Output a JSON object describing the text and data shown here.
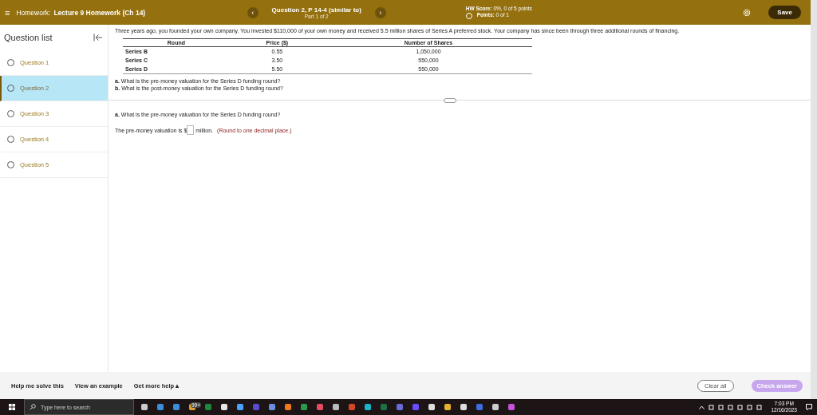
{
  "header": {
    "menu_icon": "≡",
    "prefix": "Homework:",
    "title": "Lecture 9 Homework (Ch 14)",
    "question": "Question 2, P 14-4 (similar to)",
    "part": "Part 1 of 2",
    "prev": "‹",
    "next": "›",
    "score_label": "HW Score:",
    "score": "0%, 0 of 5 points",
    "points_label": "Points:",
    "points": "0 of 1",
    "save": "Save"
  },
  "sidebar": {
    "title": "Question list",
    "items": [
      {
        "label": "Question 1",
        "selected": false
      },
      {
        "label": "Question 2",
        "selected": true
      },
      {
        "label": "Question 3",
        "selected": false
      },
      {
        "label": "Question 4",
        "selected": false
      },
      {
        "label": "Question 5",
        "selected": false
      }
    ]
  },
  "problem": {
    "intro": "Three years ago, you founded your own company. You invested $110,000 of your own money and received 5.5 million shares of Series A preferred stock. Your company has since been through three additional rounds of financing.",
    "table": {
      "columns": [
        "Round",
        "Price ($)",
        "Number of Shares"
      ],
      "rows": [
        [
          "Series B",
          "0.55",
          "1,050,000"
        ],
        [
          "Series C",
          "3.50",
          "550,000"
        ],
        [
          "Series D",
          "5.50",
          "550,000"
        ]
      ]
    },
    "questions": [
      "**a.** What is the pre-money valuation for the Series D funding round?",
      "**b.** What is the post-money valuation for the Series D funding round?"
    ]
  },
  "answer": {
    "question": "**a.** What is the pre-money valuation for the Series D funding round?",
    "before": "The pre-money valuation is $",
    "after": "million.",
    "hint": "(Round to one decimal place.)"
  },
  "footer": {
    "links": [
      "Help me solve this",
      "View an example",
      "Get more help ▴"
    ],
    "clear": "Clear all",
    "check": "Check answer"
  },
  "taskbar": {
    "search": "Type here to search",
    "badge": "99+",
    "time": "7:03 PM",
    "date": "12/16/2023"
  }
}
